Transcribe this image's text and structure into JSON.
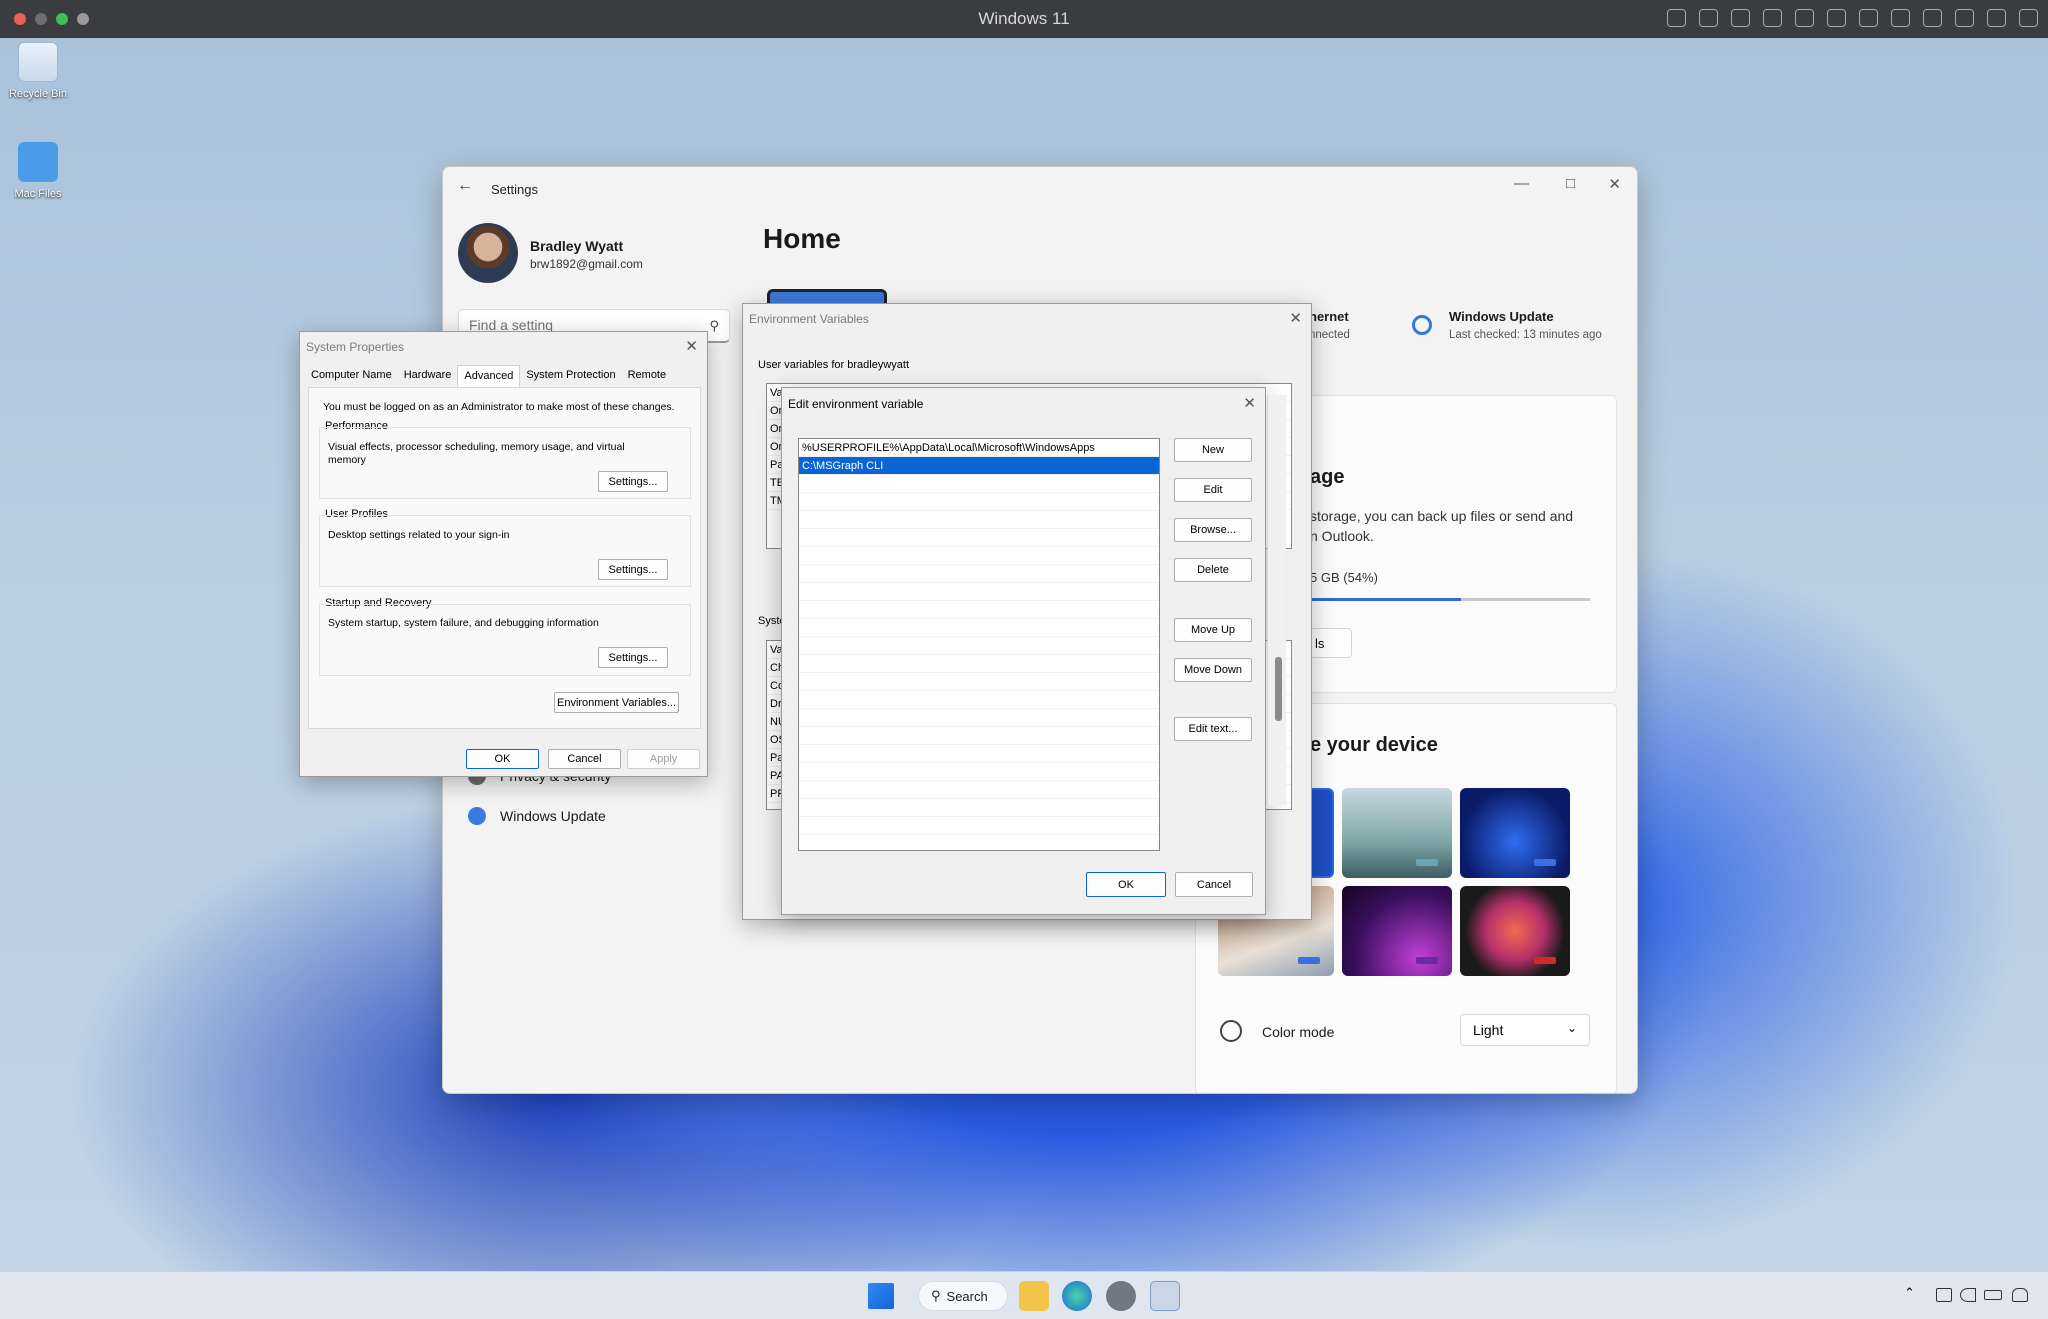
{
  "host": {
    "title": "Windows 11",
    "traffic_lights": [
      "#ec5f57",
      "#6e6e6e",
      "#3fbf55",
      "#9a9a9a"
    ]
  },
  "desktop": {
    "icons": [
      {
        "label": "Recycle Bin",
        "icon": "recycle-bin-icon"
      },
      {
        "label": "Mac Files",
        "icon": "folder-icon"
      }
    ]
  },
  "settings": {
    "title": "Settings",
    "user": {
      "name": "Bradley Wyatt",
      "email": "brw1892@gmail.com"
    },
    "search_placeholder": "Find a setting",
    "nav": [
      {
        "label": "Privacy & security",
        "icon": "shield-icon"
      },
      {
        "label": "Windows Update",
        "icon": "windows-update-icon"
      }
    ],
    "page_title": "Home",
    "ethernet": {
      "title": "hernet",
      "sub": "nnected"
    },
    "windows_update": {
      "title": "Windows Update",
      "sub": "Last checked: 13 minutes ago"
    },
    "storage": {
      "heading": "age",
      "desc_line1": "storage, you can back up files or send and",
      "desc_line2": "n Outlook.",
      "usage": "5 GB (54%)",
      "usage_fraction": 0.54,
      "button": "ls"
    },
    "personalize": {
      "heading": "e your device"
    },
    "color_mode": {
      "label": "Color mode",
      "value": "Light"
    }
  },
  "system_properties": {
    "title": "System Properties",
    "tabs": [
      "Computer Name",
      "Hardware",
      "Advanced",
      "System Protection",
      "Remote"
    ],
    "active_tab": "Advanced",
    "admin_note": "You must be logged on as an Administrator to make most of these changes.",
    "performance": {
      "label": "Performance",
      "desc": "Visual effects, processor scheduling, memory usage, and virtual memory",
      "button": "Settings..."
    },
    "user_profiles": {
      "label": "User Profiles",
      "desc": "Desktop settings related to your sign-in",
      "button": "Settings..."
    },
    "startup": {
      "label": "Startup and Recovery",
      "desc": "System startup, system failure, and debugging information",
      "button": "Settings..."
    },
    "env_button": "Environment Variables...",
    "ok": "OK",
    "cancel": "Cancel",
    "apply": "Apply"
  },
  "env_vars": {
    "title": "Environment Variables",
    "user_section": "User variables for bradleywyatt",
    "system_section": "Syste",
    "user_rows": [
      "Va",
      "Or",
      "Or",
      "Or",
      "Pa",
      "TE",
      "TM"
    ],
    "system_rows": [
      "Va",
      "Ch",
      "Co",
      "Dr",
      "NU",
      "OS",
      "Pa",
      "PA",
      "PR"
    ]
  },
  "edit_env": {
    "title": "Edit environment variable",
    "entries": [
      "%USERPROFILE%\\AppData\\Local\\Microsoft\\WindowsApps",
      "C:\\MSGraph CLI"
    ],
    "selected_index": 1,
    "buttons": {
      "new": "New",
      "edit": "Edit",
      "browse": "Browse...",
      "delete": "Delete",
      "move_up": "Move Up",
      "move_down": "Move Down",
      "edit_text": "Edit text..."
    },
    "ok": "OK",
    "cancel": "Cancel"
  },
  "taskbar": {
    "search_label": "Search"
  }
}
